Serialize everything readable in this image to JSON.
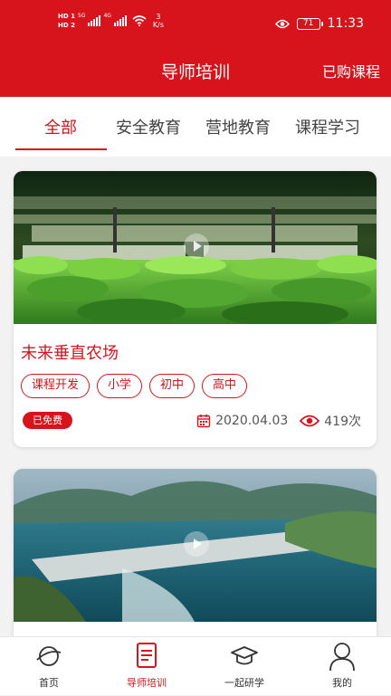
{
  "statusbar": {
    "hd1": "HD 1",
    "hd2": "HD 2",
    "sig1": "5G",
    "sig2": "4G",
    "speed_value": "3",
    "speed_unit": "K/s",
    "battery": "71",
    "time": "11:33"
  },
  "header": {
    "title": "导师培训",
    "purchased_label": "已购课程"
  },
  "tabs": [
    {
      "label": "全部",
      "active": true
    },
    {
      "label": "安全教育",
      "active": false
    },
    {
      "label": "营地教育",
      "active": false
    },
    {
      "label": "课程学习",
      "active": false
    }
  ],
  "courses": [
    {
      "title": "未来垂直农场",
      "tags": [
        "课程开发",
        "小学",
        "初中",
        "高中"
      ],
      "badge": "已免费",
      "date": "2020.04.03",
      "views": "419次"
    }
  ],
  "bottom_nav": [
    {
      "label": "首页",
      "icon": "planet-icon"
    },
    {
      "label": "导师培训",
      "icon": "document-icon"
    },
    {
      "label": "一起研学",
      "icon": "graduation-cap-icon"
    },
    {
      "label": "我的",
      "icon": "person-icon"
    }
  ],
  "colors": {
    "accent": "#d7141c"
  }
}
